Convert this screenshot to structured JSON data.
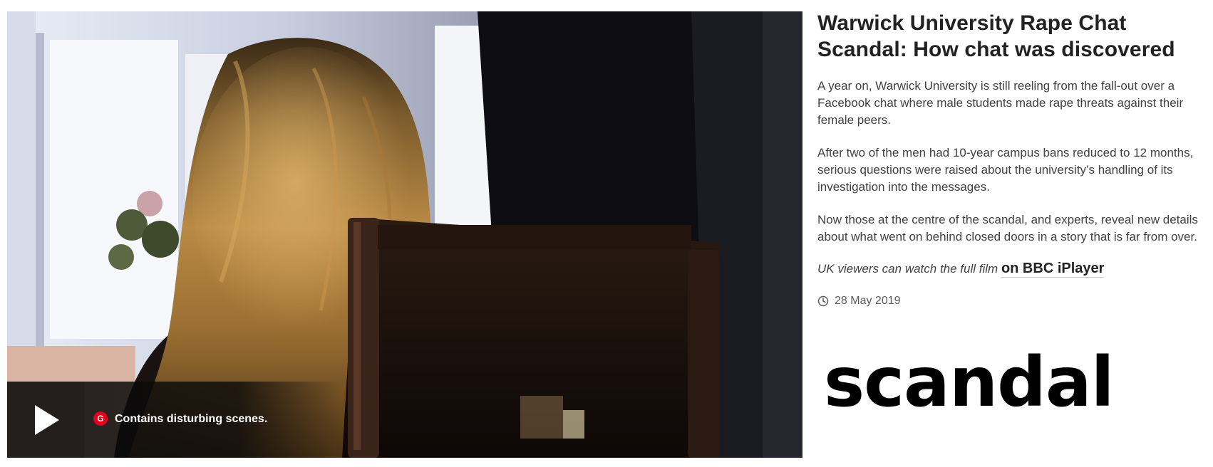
{
  "video": {
    "guidance_badge": "G",
    "guidance_text": "Contains disturbing scenes.",
    "play_icon": "play-icon"
  },
  "article": {
    "headline": "Warwick University Rape Chat Scandal: How chat was discovered",
    "paragraphs": [
      "A year on, Warwick University is still reeling from the fall-out over a Facebook chat where male students made rape threats against their female peers.",
      "After two of the men had 10-year campus bans reduced to 12 months, serious questions were raised about the university’s handling of its investigation into the messages.",
      "Now those at the centre of the scandal, and experts, reveal new details about what went on behind closed doors in a story that is far from over."
    ],
    "iplayer_prefix": "UK viewers can watch the full film",
    "iplayer_link": "on BBC iPlayer",
    "date": "28 May 2019",
    "date_icon": "clock-icon"
  },
  "overlay_keyword": "scandal",
  "colors": {
    "guidance_red": "#e2001a",
    "headline": "#222222",
    "body_text": "#404040"
  }
}
